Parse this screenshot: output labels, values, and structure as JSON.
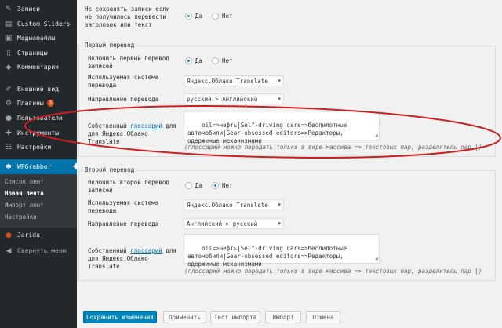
{
  "sidebar": {
    "items": [
      {
        "label": "Записи",
        "icon": "pin-icon"
      },
      {
        "label": "Custom Sliders",
        "icon": "slides-icon"
      },
      {
        "label": "Медиафайлы",
        "icon": "media-icon"
      },
      {
        "label": "Страницы",
        "icon": "page-icon"
      },
      {
        "label": "Комментарии",
        "icon": "comments-icon"
      },
      {
        "label": "Внешний вид",
        "icon": "brush-icon"
      },
      {
        "label": "Плагины",
        "icon": "plugin-icon",
        "badge": "3"
      },
      {
        "label": "Пользователи",
        "icon": "users-icon"
      },
      {
        "label": "Инструменты",
        "icon": "wrench-icon"
      },
      {
        "label": "Настройки",
        "icon": "settings-icon"
      },
      {
        "label": "WPGrabber",
        "icon": "grabber-icon"
      },
      {
        "label": "Jarida",
        "icon": "jarida-icon"
      },
      {
        "label": "Свернуть меню",
        "icon": "collapse-icon"
      }
    ],
    "submenu": [
      "Список лент",
      "Новая лента",
      "Импорт лент",
      "Настройки"
    ]
  },
  "top": {
    "label": "Не сохранять записи если не получилось перевести заголовок или текст",
    "yes": "Да",
    "no": "Нет"
  },
  "first": {
    "legend": "Первый перевод",
    "enable_label": "Включить первый перевод записей",
    "yes": "Да",
    "no": "Нет",
    "system_label": "Используемая система перевода",
    "system_value": "Яндекс.Облако Translate",
    "direction_label": "Направление перевода",
    "direction_value": "русский > Английский",
    "glossary_label_1": "Собственный",
    "glossary_link": "глоссарий",
    "glossary_label_2": "для",
    "glossary_label_3": "для Яндекс.Облако Translate",
    "glossary_value": "oil=>нефть|Self-driving cars=>беспилотные\nавтомобили|Gear-obsessed editors=>Редакторы,\nодержимые механизмами",
    "hint": "(глоссарий можно передать только в виде массива => текстовых пар, разделитель пар |)"
  },
  "second": {
    "legend": "Второй перевод",
    "enable_label": "Включить второй перевод записей",
    "yes": "Да",
    "no": "Нет",
    "system_label": "Используемая система перевода",
    "system_value": "Яндекс.Облако Translate",
    "direction_label": "Направление перевода",
    "direction_value": "Английский > русский",
    "glossary_label_1": "Собственный",
    "glossary_link": "глоссарий",
    "glossary_label_2": "для",
    "glossary_label_3": "для Яндекс.Облако Translate",
    "glossary_value": "oil=>нефть|Self-driving cars=>беспилотные\nавтомобили|Gear-obsessed editors=>Редакторы,\nодержимые механизмами",
    "hint": "(глоссарий можно передать только в виде массива => текстовых пар, разделитель пар |)"
  },
  "buttons": {
    "save": "Сохранить изменения",
    "apply": "Применить",
    "test": "Тест импорта",
    "import": "Импорт",
    "cancel": "Отмена"
  },
  "colors": {
    "sidebar_bg": "#23282d",
    "active": "#0073aa",
    "primary_button": "#0085ba",
    "annotation": "#cc1f1f"
  }
}
